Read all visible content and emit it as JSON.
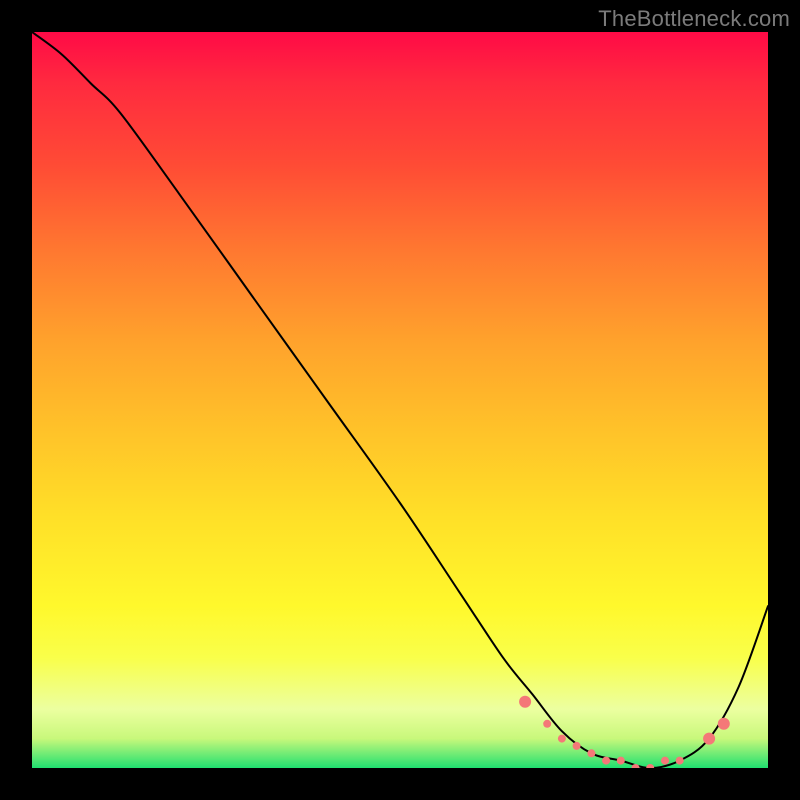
{
  "watermark": {
    "text": "TheBottleneck.com"
  },
  "chart_data": {
    "type": "line",
    "title": "",
    "xlabel": "",
    "ylabel": "",
    "xlim": [
      0,
      100
    ],
    "ylim": [
      0,
      100
    ],
    "grid": false,
    "series": [
      {
        "name": "curve",
        "x": [
          0,
          4,
          8,
          12,
          20,
          30,
          40,
          50,
          58,
          64,
          68,
          72,
          76,
          80,
          84,
          88,
          92,
          96,
          100
        ],
        "y": [
          100,
          97,
          93,
          89,
          78,
          64,
          50,
          36,
          24,
          15,
          10,
          5,
          2,
          1,
          0,
          1,
          4,
          11,
          22
        ],
        "stroke": "#000000",
        "stroke_width": 2
      }
    ],
    "points": {
      "name": "highlight-dots",
      "color": "#f47878",
      "radius_small": 4,
      "radius_large": 6,
      "items": [
        {
          "x": 67,
          "y": 9,
          "r": "large"
        },
        {
          "x": 70,
          "y": 6,
          "r": "small"
        },
        {
          "x": 72,
          "y": 4,
          "r": "small"
        },
        {
          "x": 74,
          "y": 3,
          "r": "small"
        },
        {
          "x": 76,
          "y": 2,
          "r": "small"
        },
        {
          "x": 78,
          "y": 1,
          "r": "small"
        },
        {
          "x": 80,
          "y": 1,
          "r": "small"
        },
        {
          "x": 82,
          "y": 0,
          "r": "small"
        },
        {
          "x": 84,
          "y": 0,
          "r": "small"
        },
        {
          "x": 86,
          "y": 1,
          "r": "small"
        },
        {
          "x": 88,
          "y": 1,
          "r": "small"
        },
        {
          "x": 92,
          "y": 4,
          "r": "large"
        },
        {
          "x": 94,
          "y": 6,
          "r": "large"
        }
      ]
    }
  }
}
